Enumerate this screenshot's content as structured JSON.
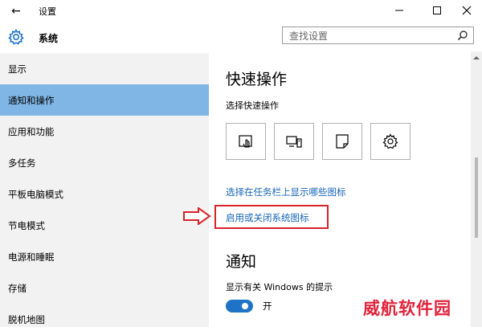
{
  "window": {
    "back_glyph": "←",
    "title": "设置"
  },
  "header": {
    "app_title": "系统",
    "search_placeholder": "查找设置"
  },
  "sidebar": {
    "items": [
      {
        "label": "显示"
      },
      {
        "label": "通知和操作",
        "selected": true
      },
      {
        "label": "应用和功能"
      },
      {
        "label": "多任务"
      },
      {
        "label": "平板电脑模式"
      },
      {
        "label": "节电模式"
      },
      {
        "label": "电源和睡眠"
      },
      {
        "label": "存储"
      },
      {
        "label": "脱机地图"
      }
    ]
  },
  "main": {
    "quick_actions_heading": "快速操作",
    "quick_actions_sub": "选择快速操作",
    "tiles": [
      {
        "icon": "tablet-mode-icon"
      },
      {
        "icon": "project-icon"
      },
      {
        "icon": "note-icon"
      },
      {
        "icon": "settings-gear-icon"
      }
    ],
    "link_taskbar_icons": "选择在任务栏上显示哪些图标",
    "link_system_icons": "启用或关闭系统图标",
    "notifications_heading": "通知",
    "notifications_sub": "显示有关 Windows 的提示",
    "toggle_label": "开",
    "toggle_on": true
  },
  "watermark": "威航软件园",
  "colors": {
    "accent": "#1e73c6",
    "selected_bg": "#7fb6e6",
    "link": "#1665b7",
    "highlight": "#d8232a",
    "sidebar_bg": "#f2f2f2"
  }
}
